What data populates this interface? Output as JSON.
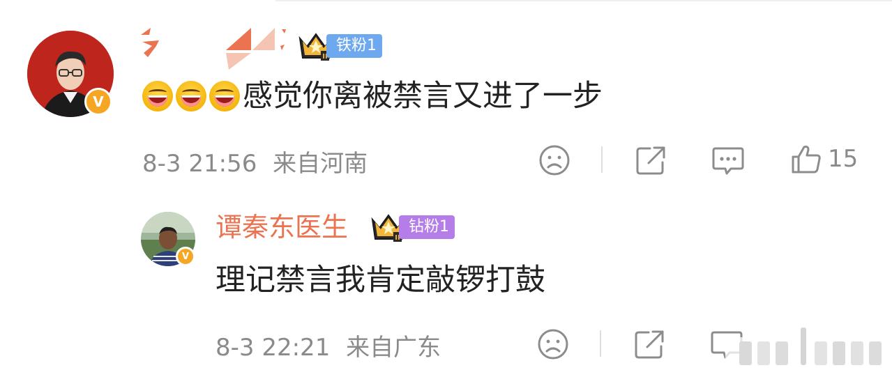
{
  "comments": [
    {
      "username": "",
      "fan_badge": {
        "label": "铁粉1",
        "color": "#6ea8ee"
      },
      "content": "感觉你离被禁言又进了一步",
      "emojis": [
        "grinning-face-emoji",
        "grinning-face-emoji",
        "grinning-face-emoji"
      ],
      "time": "8-3 21:56",
      "location": "来自河南",
      "like_count": "15",
      "verified_badge": "V"
    },
    {
      "username": "谭秦东医生",
      "fan_badge": {
        "label": "钻粉1",
        "color": "#b57de8"
      },
      "content": "理记禁言我肯定敲锣打鼓",
      "time": "8-3 22:21",
      "location": "来自广东",
      "verified_badge": "V"
    }
  ],
  "colors": {
    "username": "#eb7350",
    "meta": "#8a8a8a",
    "text": "#222222",
    "icon": "#8c8c8c"
  },
  "icons": [
    "frown-icon",
    "share-icon",
    "comment-icon",
    "thumbs-up-icon"
  ]
}
